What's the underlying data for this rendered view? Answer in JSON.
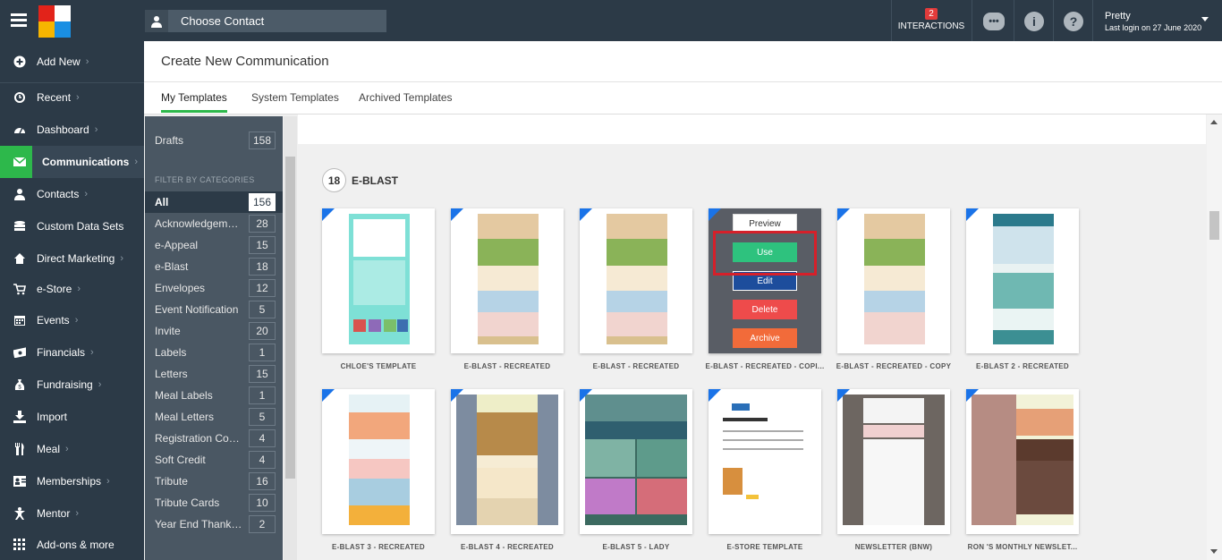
{
  "topbar": {
    "contact_placeholder": "Choose Contact",
    "interactions_count": "2",
    "interactions_label": "INTERACTIONS",
    "user_name": "Pretty",
    "last_login": "Last login on 27 June 2020"
  },
  "sidebar": {
    "items": [
      {
        "label": "Add New",
        "icon": "plus-circle-icon"
      },
      {
        "label": "Recent",
        "icon": "history-icon"
      },
      {
        "label": "Dashboard",
        "icon": "dashboard-icon"
      },
      {
        "label": "Communications",
        "icon": "envelope-icon"
      },
      {
        "label": "Contacts",
        "icon": "user-icon"
      },
      {
        "label": "Custom Data Sets",
        "icon": "database-icon"
      },
      {
        "label": "Direct Marketing",
        "icon": "home-icon"
      },
      {
        "label": "e-Store",
        "icon": "cart-icon"
      },
      {
        "label": "Events",
        "icon": "calendar-icon"
      },
      {
        "label": "Financials",
        "icon": "money-icon"
      },
      {
        "label": "Fundraising",
        "icon": "moneybag-icon"
      },
      {
        "label": "Import",
        "icon": "import-icon"
      },
      {
        "label": "Meal",
        "icon": "cutlery-icon"
      },
      {
        "label": "Memberships",
        "icon": "id-card-icon"
      },
      {
        "label": "Mentor",
        "icon": "mentor-icon"
      },
      {
        "label": "Add-ons & more",
        "icon": "grid-icon"
      }
    ]
  },
  "header": {
    "title": "Create New Communication"
  },
  "tabs": [
    {
      "label": "My Templates"
    },
    {
      "label": "System Templates"
    },
    {
      "label": "Archived Templates"
    }
  ],
  "filters": {
    "drafts_label": "Drafts",
    "drafts_count": "158",
    "heading": "FILTER BY CATEGORIES",
    "categories": [
      {
        "name": "All",
        "count": "156"
      },
      {
        "name": "Acknowledgeme...",
        "count": "28"
      },
      {
        "name": "e-Appeal",
        "count": "15"
      },
      {
        "name": "e-Blast",
        "count": "18"
      },
      {
        "name": "Envelopes",
        "count": "12"
      },
      {
        "name": "Event Notification",
        "count": "5"
      },
      {
        "name": "Invite",
        "count": "20"
      },
      {
        "name": "Labels",
        "count": "1"
      },
      {
        "name": "Letters",
        "count": "15"
      },
      {
        "name": "Meal Labels",
        "count": "1"
      },
      {
        "name": "Meal Letters",
        "count": "5"
      },
      {
        "name": "Registration Con...",
        "count": "4"
      },
      {
        "name": "Soft Credit",
        "count": "4"
      },
      {
        "name": "Tribute",
        "count": "16"
      },
      {
        "name": "Tribute Cards",
        "count": "10"
      },
      {
        "name": "Year End Thank ...",
        "count": "2"
      }
    ]
  },
  "section": {
    "count": "18",
    "title": "E-BLAST"
  },
  "hover_buttons": {
    "preview": "Preview",
    "use": "Use",
    "edit": "Edit",
    "delete": "Delete",
    "archive": "Archive"
  },
  "templates": [
    {
      "label": "CHLOE'S TEMPLATE"
    },
    {
      "label": "E-BLAST - RECREATED"
    },
    {
      "label": "E-BLAST - RECREATED"
    },
    {
      "label": "E-BLAST - RECREATED - COPI..."
    },
    {
      "label": "E-BLAST - RECREATED - COPY"
    },
    {
      "label": "E-BLAST 2 - RECREATED"
    },
    {
      "label": "E-BLAST 3 - RECREATED"
    },
    {
      "label": "E-BLAST 4 - RECREATED"
    },
    {
      "label": "E-BLAST 5 - LADY"
    },
    {
      "label": "E-STORE TEMPLATE"
    },
    {
      "label": "NEWSLETTER (BNW)"
    },
    {
      "label": "RON 'S MONTHLY NEWSLET..."
    }
  ]
}
